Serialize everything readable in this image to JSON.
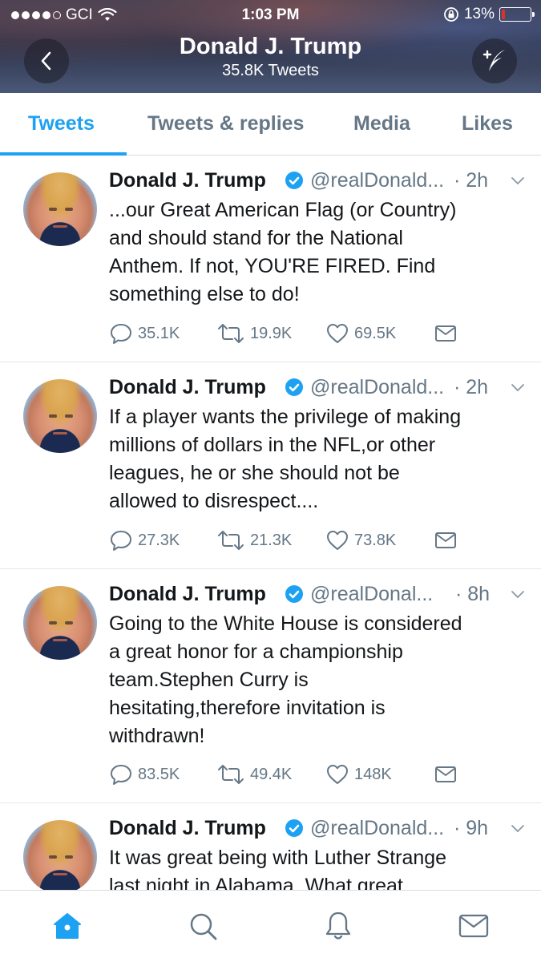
{
  "status_bar": {
    "carrier": "GCI",
    "time": "1:03 PM",
    "battery": "13%",
    "battery_level": 0.13,
    "battery_color": "#e0302a"
  },
  "header": {
    "back_icon": "chevron-left-icon",
    "profile_name": "Donald J. Trump",
    "tweet_count": "35.8K Tweets",
    "compose_icon": "compose-tweet-icon"
  },
  "tabs": [
    {
      "label": "Tweets",
      "active": true
    },
    {
      "label": "Tweets & replies",
      "active": false
    },
    {
      "label": "Media",
      "active": false
    },
    {
      "label": "Likes",
      "active": false
    }
  ],
  "colors": {
    "accent": "#1da1f2",
    "secondary_text": "#657786",
    "primary_text": "#14171a"
  },
  "tweets": [
    {
      "name": "Donald J. Trump",
      "handle": "@realDonald...",
      "time": "· 2h",
      "lines": [
        "...our Great American Flag (or Country)",
        "and should stand for the National",
        "Anthem. If not, YOU'RE FIRED. Find",
        "something else to do!"
      ],
      "replies": "35.1K",
      "retweets": "19.9K",
      "likes": "69.5K"
    },
    {
      "name": "Donald J. Trump",
      "handle": "@realDonald...",
      "time": "· 2h",
      "lines": [
        "If a player wants the privilege of making",
        "millions of dollars in the NFL,or other",
        "leagues, he or she should not be",
        "allowed to disrespect...."
      ],
      "replies": "27.3K",
      "retweets": "21.3K",
      "likes": "73.8K"
    },
    {
      "name": "Donald J. Trump",
      "handle": "@realDonal...",
      "time": "· 8h",
      "lines": [
        "Going to the White House is considered",
        "a great honor for a championship",
        "team.Stephen Curry is",
        "hesitating,therefore invitation is",
        "withdrawn!"
      ],
      "replies": "83.5K",
      "retweets": "49.4K",
      "likes": "148K"
    },
    {
      "name": "Donald J. Trump",
      "handle": "@realDonald...",
      "time": "· 9h",
      "lines": [
        "It was great being with Luther Strange",
        "last night in Alabama. What great"
      ]
    }
  ],
  "bottom_nav": [
    "home-icon",
    "search-icon",
    "notifications-bell-icon",
    "messages-envelope-icon"
  ]
}
